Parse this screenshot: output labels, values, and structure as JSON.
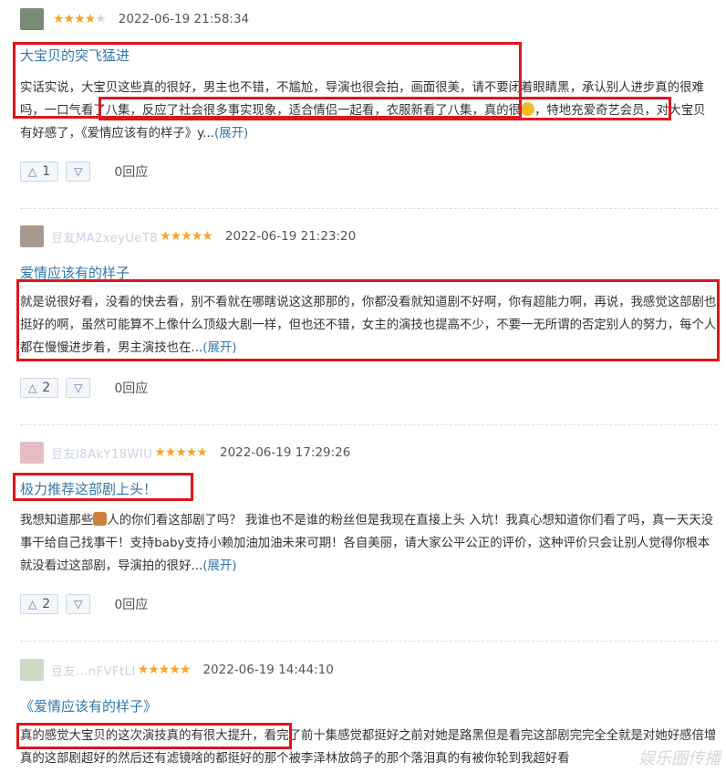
{
  "reviews": [
    {
      "user": "",
      "stars": "★★★★",
      "stars_off": "★",
      "date": "2022-06-19 21:58:34",
      "title": "大宝贝的突飞猛进",
      "body_a": "实话实说，大宝贝这些真的很好，男主也不错，不尴尬，导演也很会拍，画面很美，请不要闭着眼睛黑，承认别人进步真的很难吗，一口气看了八集，反应了社会很多事实现象，适合情侣一起看，衣服新看了八集，真的很",
      "body_b": "，特地充爱奇艺会员，对大宝贝有好感了，《爱情应该有的样子》y...",
      "more": "(展开)",
      "up": "1",
      "replies": "0回应"
    },
    {
      "user": "豆友MA2xeyUeT8",
      "stars": "★★★★★",
      "date": "2022-06-19 21:23:20",
      "title": "爱情应该有的样子",
      "body_a": "就是说很好看，没看的快去看，别不看就在哪瞎说这这那那的，你都没看就知道剧不好啊，你有超能力啊，再说，我感觉这部剧也挺好的啊，虽然可能算不上像什么顶级大剧一样，但也还不错，女主的演技也提高不少，不要一无所谓的否定别人的努力，每个人都在慢慢进步着，男主演技也在...",
      "more": "(展开)",
      "up": "2",
      "replies": "0回应"
    },
    {
      "user": "豆友I8AkY18WIU",
      "stars": "★★★★★",
      "date": "2022-06-19 17:29:26",
      "title": "极力推荐这部剧上头！",
      "body_a": "我想知道那些",
      "body_b": "人的你们看这部剧了吗？ 我谁也不是谁的粉丝但是我现在直接上头 入坑！我真心想知道你们看了吗，真一天天没事干给自己找事干！支持baby支持小赖加油加油未来可期！各自美丽，请大家公平公正的评价，这种评价只会让别人觉得你根本就没看过这部剧，导演拍的很好...",
      "more": "(展开)",
      "up": "2",
      "replies": "0回应"
    },
    {
      "user": "豆友...nFVFtLI",
      "stars": "★★★★★",
      "date": "2022-06-19 14:44:10",
      "title": "《爱情应该有的样子》",
      "body_a": "真的感觉大宝贝的这次演技真的有很大提升，看完了前十集感觉都挺好之前对她是路黑但是看完这部剧完完全全就是对她好感倍增真的这部剧超好的然后还有滤镜啥的都挺好的那个被李泽林放鸽子的那个落泪真的有被你轮到我超好看",
      "up": "",
      "replies": ""
    }
  ],
  "watermark": "娱乐圈传播"
}
